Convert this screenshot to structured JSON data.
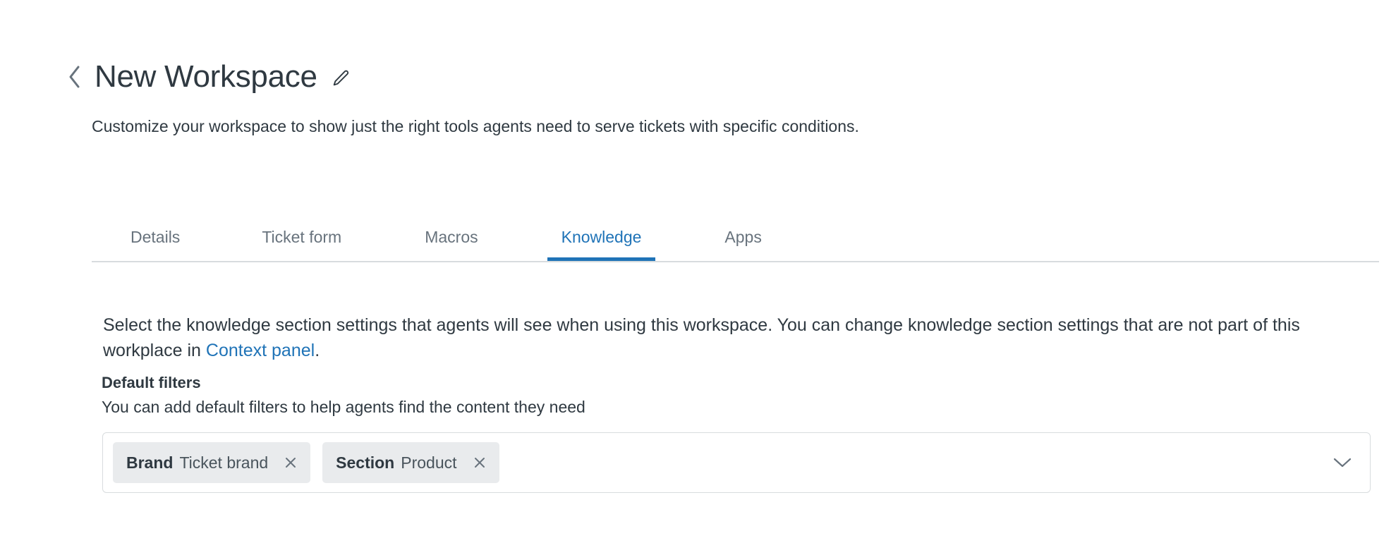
{
  "header": {
    "back_icon": "chevron-left-icon",
    "title": "New Workspace",
    "edit_icon": "pencil-icon",
    "subtitle": "Customize your workspace to show just the right tools agents need to serve tickets with specific conditions."
  },
  "tabs": [
    {
      "label": "Details",
      "active": false
    },
    {
      "label": "Ticket form",
      "active": false
    },
    {
      "label": "Macros",
      "active": false
    },
    {
      "label": "Knowledge",
      "active": true
    },
    {
      "label": "Apps",
      "active": false
    }
  ],
  "body": {
    "paragraph_before_link": "Select the knowledge section settings that agents will see when using this workspace. You can change knowledge section settings that are not part of this workplace in ",
    "link_label": "Context panel",
    "paragraph_after_link": "."
  },
  "default_filters": {
    "title": "Default filters",
    "description": "You can add default filters to help agents find the content they need",
    "chips": [
      {
        "key": "Brand",
        "value": "Ticket brand",
        "remove_icon": "close-icon"
      },
      {
        "key": "Section",
        "value": "Product",
        "remove_icon": "close-icon"
      }
    ],
    "dropdown_icon": "chevron-down-icon"
  },
  "colors": {
    "accent": "#1f73b7",
    "text": "#2f3941",
    "muted_text": "#68737d",
    "border": "#d8dcde",
    "chip_bg": "#e9ebed",
    "background": "#ffffff"
  }
}
